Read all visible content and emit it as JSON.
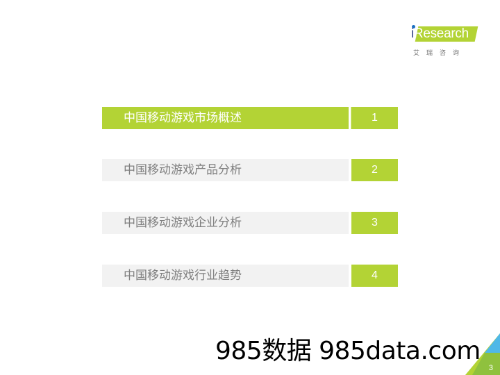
{
  "logo": {
    "brand_i": "i",
    "brand_rest": "Research",
    "brand_cn": "艾瑞咨询"
  },
  "toc": {
    "items": [
      {
        "label": "中国移动游戏市场概述",
        "number": "1",
        "active": true
      },
      {
        "label": "中国移动游戏产品分析",
        "number": "2",
        "active": false
      },
      {
        "label": "中国移动游戏企业分析",
        "number": "3",
        "active": false
      },
      {
        "label": "中国移动游戏行业趋势",
        "number": "4",
        "active": false
      }
    ]
  },
  "watermark": "985数据 985data.com",
  "page_number": "3",
  "colors": {
    "accent_green": "#b3d335",
    "inactive_bg": "#f2f2f2",
    "inactive_text": "#7f7f7f",
    "corner_blue": "#4fb8e8"
  }
}
